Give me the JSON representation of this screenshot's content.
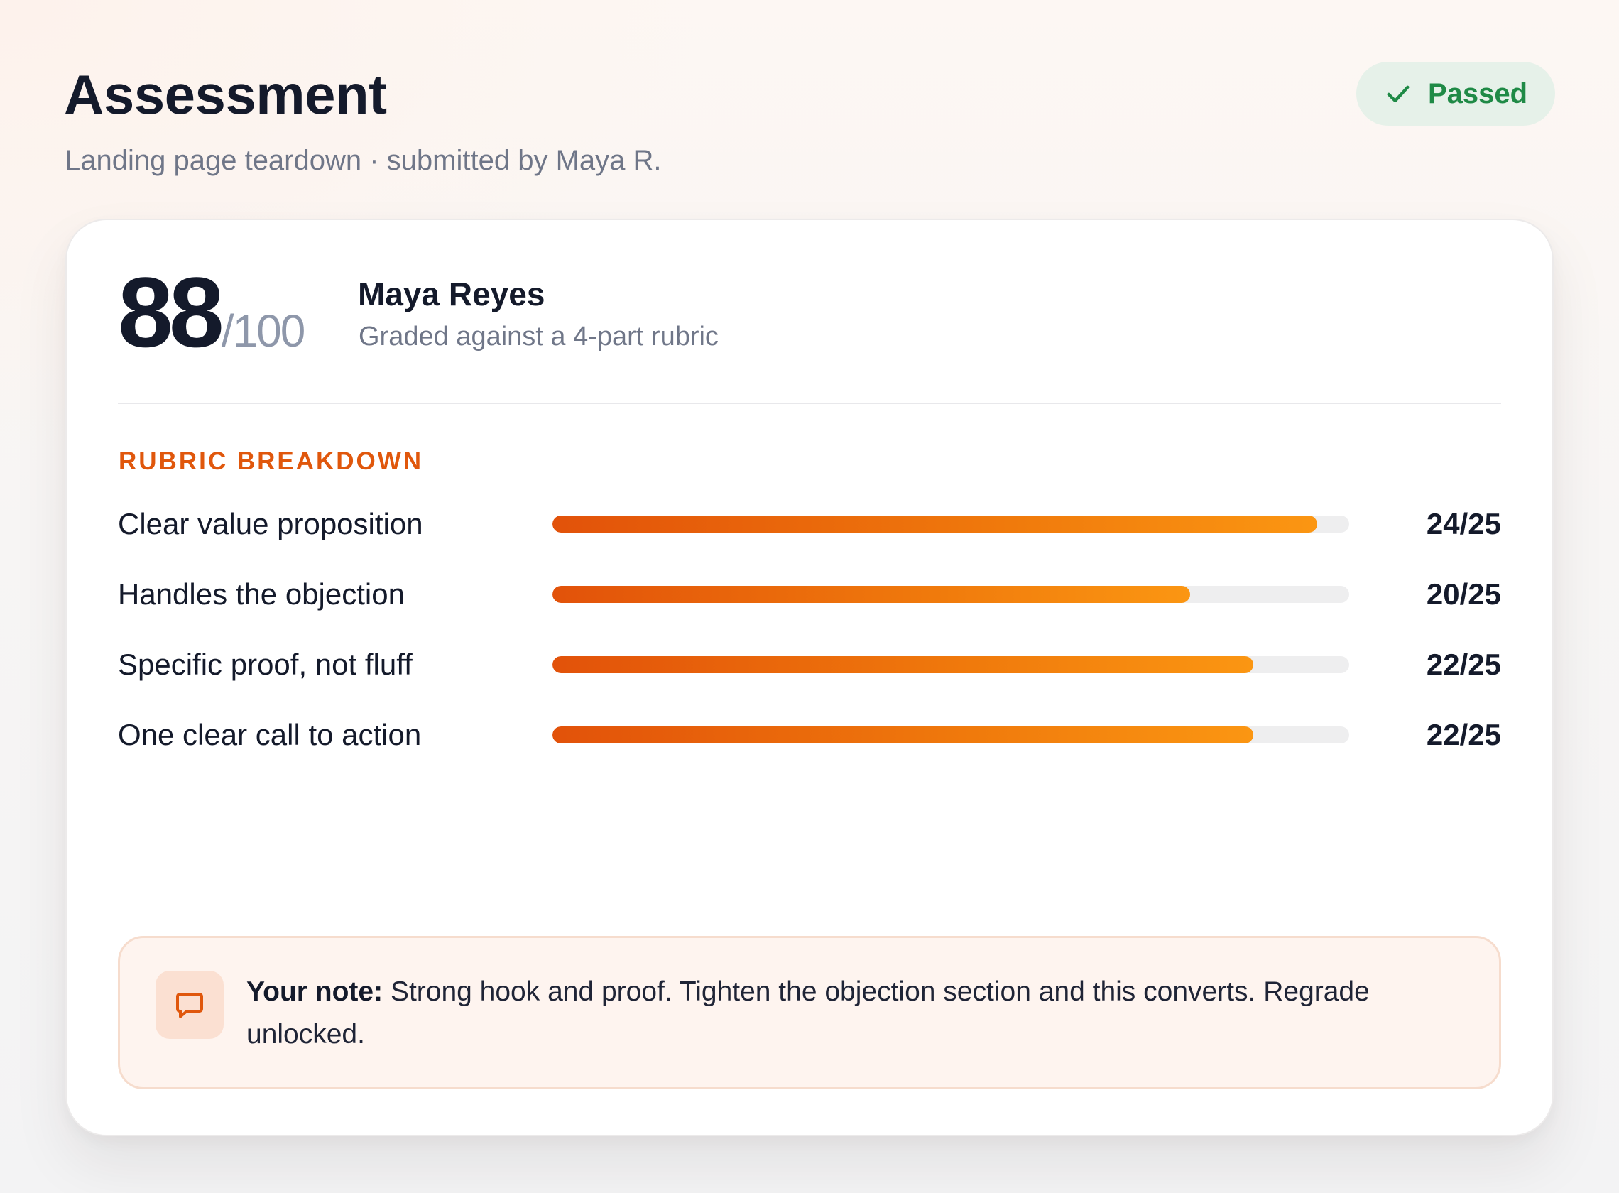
{
  "header": {
    "title": "Assessment",
    "subtitle": "Landing page teardown · submitted by Maya R.",
    "status": {
      "label": "Passed",
      "icon": "check-icon",
      "color": "#1f8a46"
    }
  },
  "summary": {
    "score": "88",
    "score_max": "/100",
    "student_name": "Maya Reyes",
    "grading_note": "Graded against a 4-part rubric"
  },
  "rubric": {
    "heading": "RUBRIC BREAKDOWN",
    "accent_color": "#e0570c",
    "items": [
      {
        "label": "Clear value proposition",
        "points": 24,
        "max": 25,
        "score_text": "24/25"
      },
      {
        "label": "Handles the objection",
        "points": 20,
        "max": 25,
        "score_text": "20/25"
      },
      {
        "label": "Specific proof, not fluff",
        "points": 22,
        "max": 25,
        "score_text": "22/25"
      },
      {
        "label": "One clear call to action",
        "points": 22,
        "max": 25,
        "score_text": "22/25"
      }
    ]
  },
  "feedback": {
    "icon": "message-icon",
    "label": "Your note:",
    "text": " Strong hook and proof. Tighten the objection section and this converts. Regrade unlocked."
  }
}
